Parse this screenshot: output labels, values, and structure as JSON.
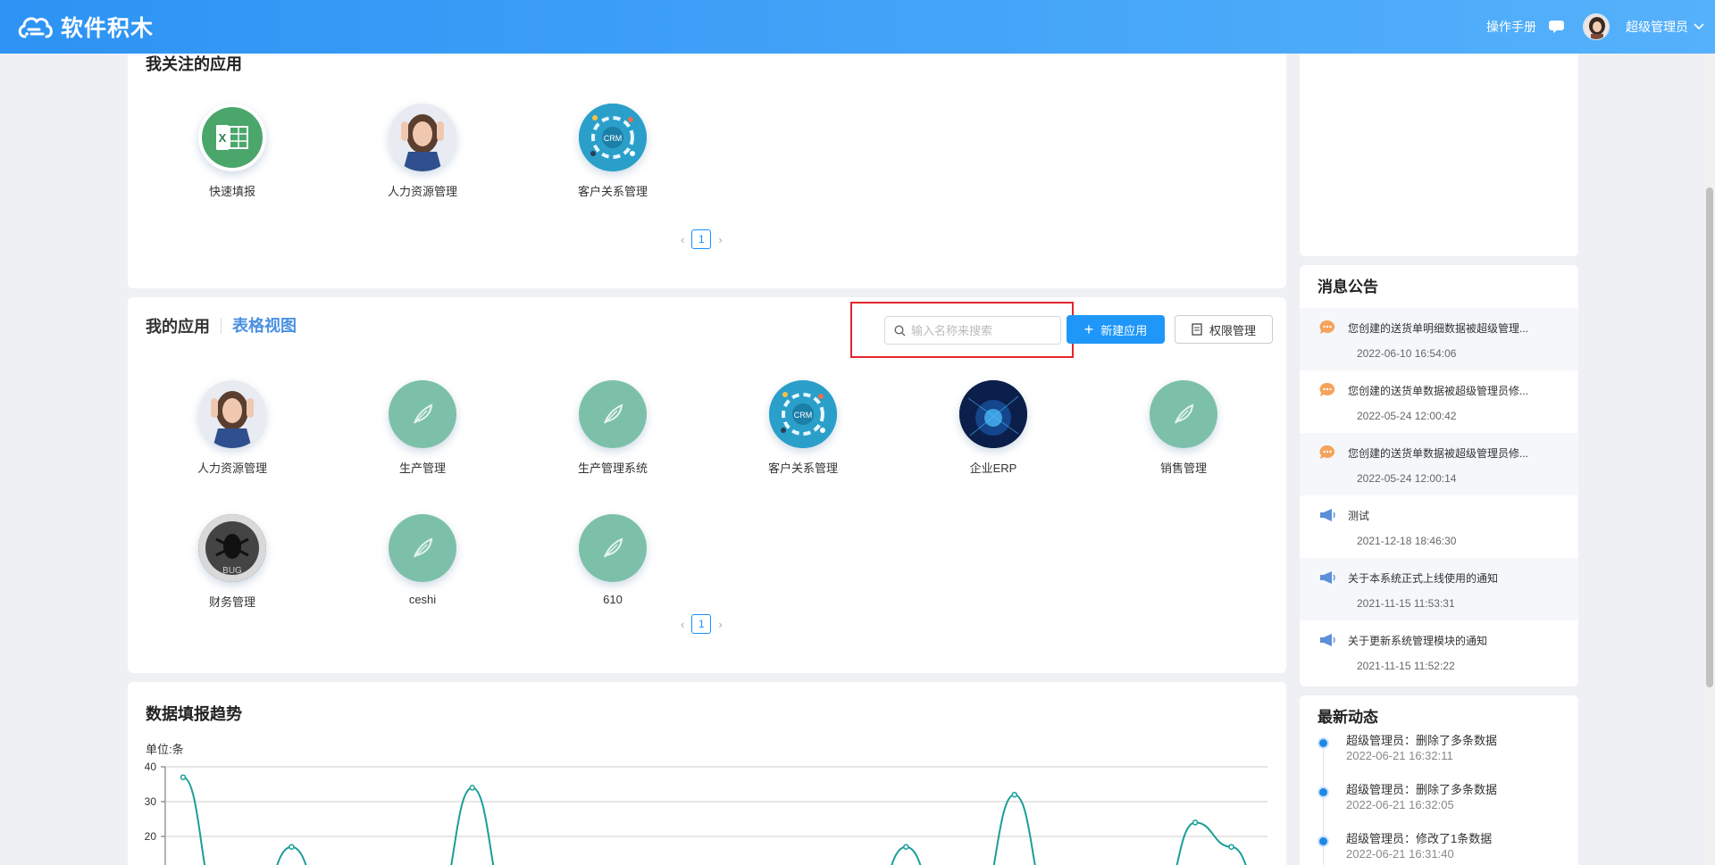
{
  "header": {
    "logo_text": "软件积木",
    "manual": "操作手册",
    "username": "超级管理员"
  },
  "followed": {
    "title": "我关注的应用",
    "apps": [
      {
        "name": "快速填报",
        "icon": "excel-icon"
      },
      {
        "name": "人力资源管理",
        "icon": "photo-woman"
      },
      {
        "name": "客户关系管理",
        "icon": "crm-icon"
      }
    ],
    "page": "1"
  },
  "myapps": {
    "title": "我的应用",
    "table_view": "表格视图",
    "search_placeholder": "输入名称来搜索",
    "new_app": "新建应用",
    "permission": "权限管理",
    "apps": [
      {
        "name": "人力资源管理",
        "icon": "photo-woman"
      },
      {
        "name": "生产管理",
        "icon": "leaf-icon"
      },
      {
        "name": "生产管理系统",
        "icon": "leaf-icon"
      },
      {
        "name": "客户关系管理",
        "icon": "crm-icon"
      },
      {
        "name": "企业ERP",
        "icon": "erp-icon"
      },
      {
        "name": "销售管理",
        "icon": "leaf-icon"
      },
      {
        "name": "财务管理",
        "icon": "bug-icon"
      },
      {
        "name": "ceshi",
        "icon": "leaf-icon"
      },
      {
        "name": "610",
        "icon": "leaf-icon"
      }
    ],
    "page": "1"
  },
  "trend": {
    "title": "数据填报趋势",
    "unit": "单位:条"
  },
  "announcements": {
    "title": "消息公告",
    "items": [
      {
        "title": "您创建的送货单明细数据被超级管理...",
        "time": "2022-06-10 16:54:06",
        "icon": "message-icon"
      },
      {
        "title": "您创建的送货单数据被超级管理员修...",
        "time": "2022-05-24 12:00:42",
        "icon": "message-icon"
      },
      {
        "title": "您创建的送货单数据被超级管理员修...",
        "time": "2022-05-24 12:00:14",
        "icon": "message-icon"
      },
      {
        "title": "测试",
        "time": "2021-12-18 18:46:30",
        "icon": "megaphone-icon"
      },
      {
        "title": "关于本系统正式上线使用的通知",
        "time": "2021-11-15 11:53:31",
        "icon": "megaphone-icon"
      },
      {
        "title": "关于更新系统管理模块的通知",
        "time": "2021-11-15 11:52:22",
        "icon": "megaphone-icon"
      }
    ]
  },
  "activity": {
    "title": "最新动态",
    "items": [
      {
        "text": "超级管理员：删除了多条数据",
        "time": "2022-06-21 16:32:11"
      },
      {
        "text": "超级管理员：删除了多条数据",
        "time": "2022-06-21 16:32:05"
      },
      {
        "text": "超级管理员：修改了1条数据",
        "time": "2022-06-21 16:31:40"
      }
    ]
  },
  "chart_data": {
    "type": "line",
    "title": "数据填报趋势",
    "ylabel": "单位:条",
    "ylim": [
      0,
      40
    ],
    "yticks": [
      40,
      30,
      20
    ],
    "series": [
      {
        "values": [
          37,
          0,
          0,
          17,
          0,
          0,
          0,
          0,
          34,
          0,
          0,
          0,
          0,
          0,
          0,
          0,
          0,
          0,
          0,
          0,
          17,
          0,
          0,
          32,
          0,
          0,
          0,
          0,
          24,
          17,
          0
        ]
      }
    ],
    "grid": true,
    "color": "#1a9e98"
  }
}
